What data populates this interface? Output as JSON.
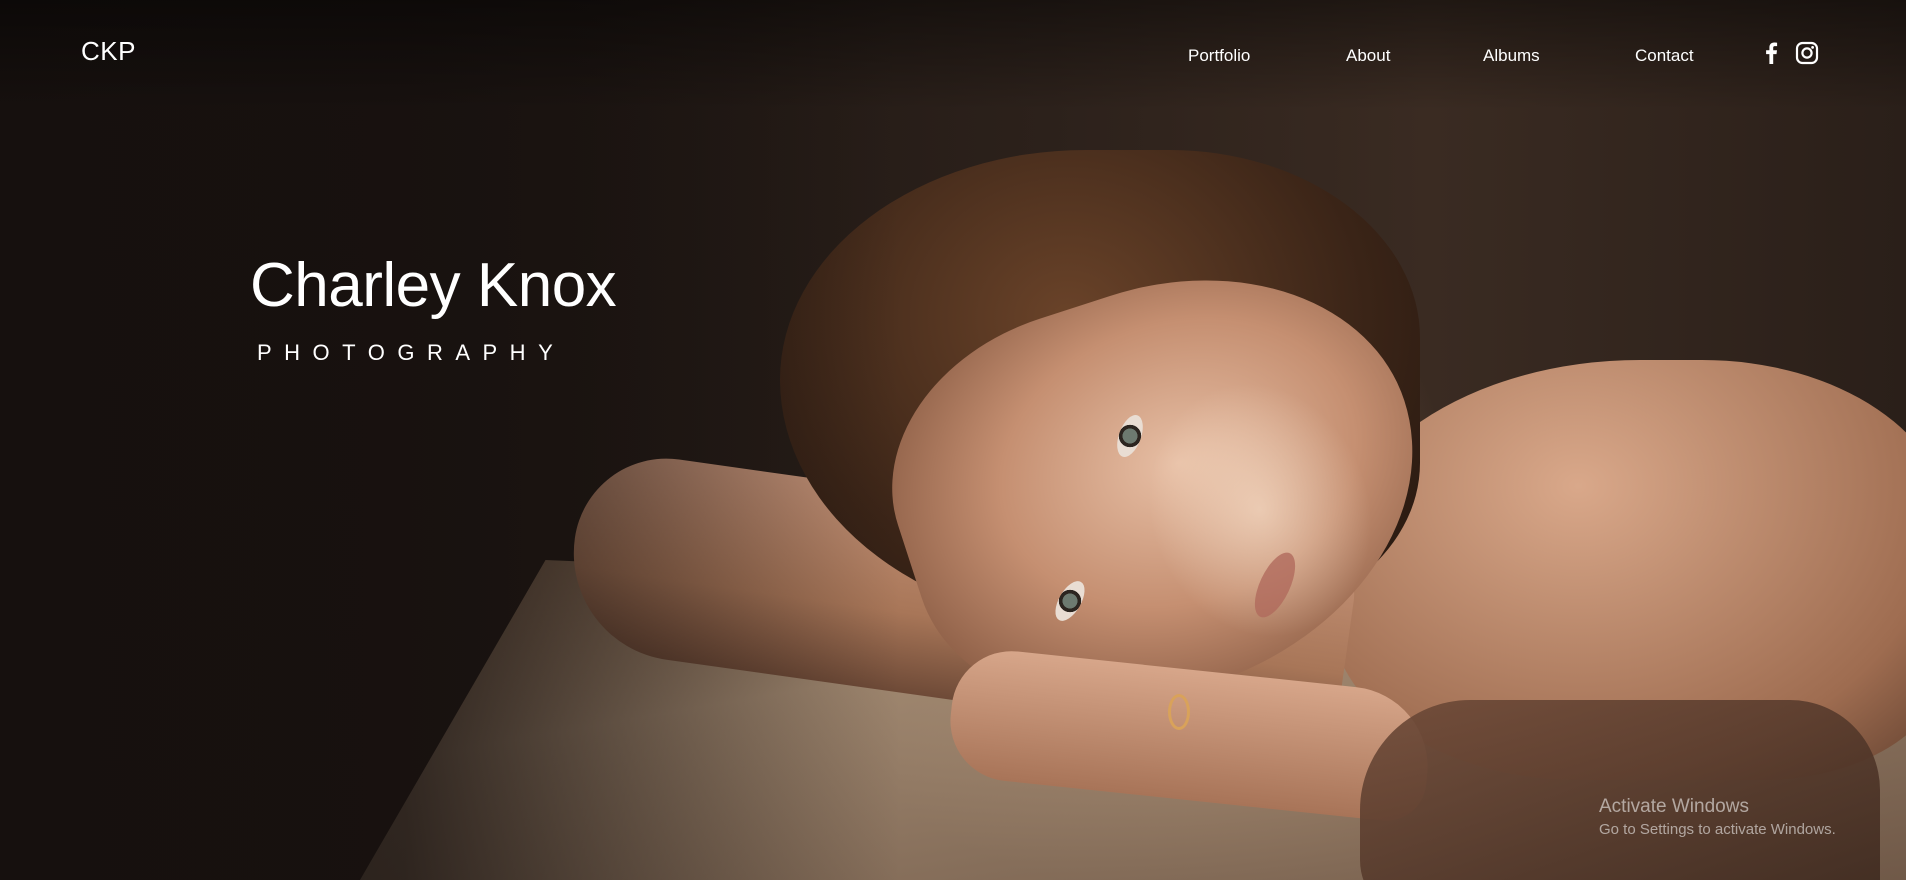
{
  "header": {
    "logo": "CKP",
    "nav": [
      {
        "label": "Portfolio"
      },
      {
        "label": "About"
      },
      {
        "label": "Albums"
      },
      {
        "label": "Contact"
      }
    ],
    "social": [
      {
        "icon": "facebook-icon"
      },
      {
        "icon": "instagram-icon"
      }
    ]
  },
  "hero": {
    "title": "Charley Knox",
    "subtitle": "PHOTOGRAPHY",
    "image": "portrait-photo"
  },
  "watermark": {
    "title": "Activate Windows",
    "subtitle": "Go to Settings to activate Windows."
  },
  "colors": {
    "background": "#1a1310",
    "text": "#ffffff"
  }
}
